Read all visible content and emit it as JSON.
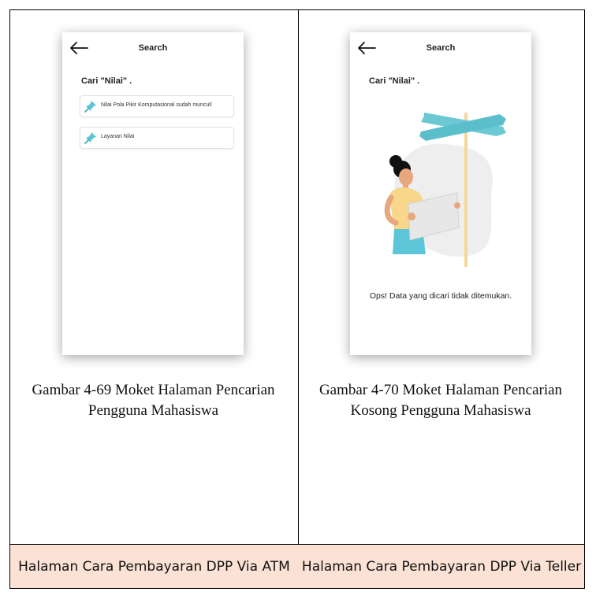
{
  "mockups": [
    {
      "header_title": "Search",
      "query_text": "Cari \"Nilai\" .",
      "results": [
        {
          "icon": "pin-icon",
          "label": "Nilai Pola Pikir Komputasional sudah muncul!"
        },
        {
          "icon": "pin-icon",
          "label": "Layanan Nilai"
        }
      ]
    },
    {
      "header_title": "Search",
      "query_text": "Cari \"Nilai\" .",
      "empty_message": "Ops! Data yang dicari tidak ditemukan.",
      "illustration": "person-holding-map-signpost"
    }
  ],
  "captions": [
    "Gambar 4-69 Moket Halaman Pencarian Pengguna Mahasiswa",
    "Gambar 4-70 Moket Halaman Pencarian Kosong Pengguna Mahasiswa"
  ],
  "footer": {
    "left": "Halaman Cara Pembayaran DPP Via ATM",
    "right": "Halaman Cara Pembayaran DPP Via Teller"
  },
  "colors": {
    "footer_bg": "#fbe2d5",
    "pin_accent": "#5bc4d6",
    "signpost": "#6cc9d3"
  }
}
